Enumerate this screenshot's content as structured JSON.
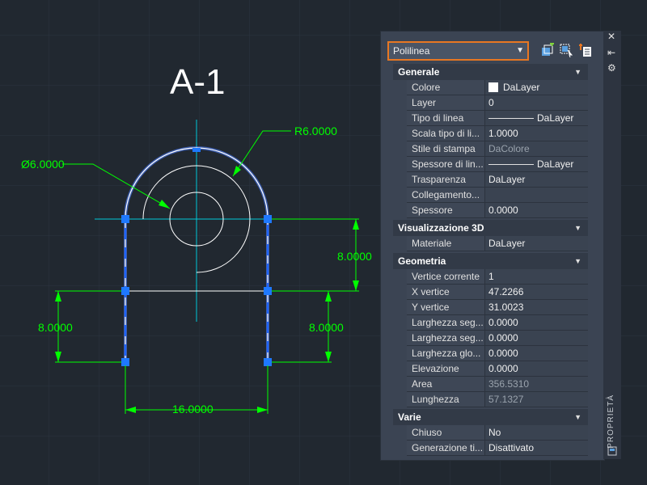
{
  "drawing": {
    "title": "A-1",
    "dims": {
      "radius": "R6.0000",
      "diameter": "Ø6.0000",
      "height_right_upper": "8.0000",
      "height_left": "8.0000",
      "height_right_lower": "8.0000",
      "width_bottom": "16.0000"
    }
  },
  "panel": {
    "object_type": "Polilinea",
    "side_title": "PROPRIETÀ",
    "icons": [
      "quick-select-icon",
      "select-objects-icon",
      "toggle-pickadd-icon"
    ],
    "categories": [
      {
        "name": "Generale",
        "rows": [
          {
            "name": "Colore",
            "value": "DaLayer"
          },
          {
            "name": "Layer",
            "value": "0"
          },
          {
            "name": "Tipo di linea",
            "value": "DaLayer"
          },
          {
            "name": "Scala tipo di li...",
            "value": "1.0000"
          },
          {
            "name": "Stile di stampa",
            "value": "DaColore"
          },
          {
            "name": "Spessore di lin...",
            "value": "DaLayer"
          },
          {
            "name": "Trasparenza",
            "value": "DaLayer"
          },
          {
            "name": "Collegamento...",
            "value": ""
          },
          {
            "name": "Spessore",
            "value": "0.0000"
          }
        ]
      },
      {
        "name": "Visualizzazione 3D",
        "rows": [
          {
            "name": "Materiale",
            "value": "DaLayer"
          }
        ]
      },
      {
        "name": "Geometria",
        "rows": [
          {
            "name": "Vertice corrente",
            "value": "1"
          },
          {
            "name": "X vertice",
            "value": "47.2266"
          },
          {
            "name": "Y vertice",
            "value": "31.0023"
          },
          {
            "name": "Larghezza seg...",
            "value": "0.0000"
          },
          {
            "name": "Larghezza seg...",
            "value": "0.0000"
          },
          {
            "name": "Larghezza glo...",
            "value": "0.0000"
          },
          {
            "name": "Elevazione",
            "value": "0.0000"
          },
          {
            "name": "Area",
            "value": "356.5310"
          },
          {
            "name": "Lunghezza",
            "value": "57.1327"
          }
        ]
      },
      {
        "name": "Varie",
        "rows": [
          {
            "name": "Chiuso",
            "value": "No"
          },
          {
            "name": "Generazione ti...",
            "value": "Disattivato"
          }
        ]
      }
    ]
  }
}
